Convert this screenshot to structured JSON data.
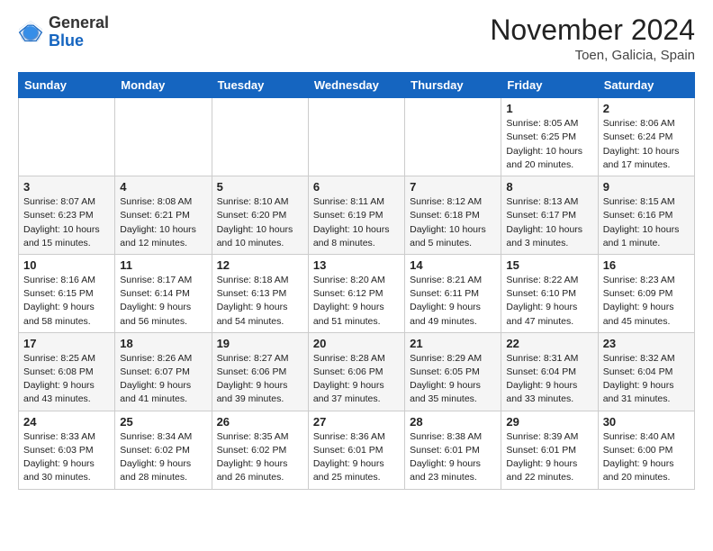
{
  "logo": {
    "general": "General",
    "blue": "Blue"
  },
  "header": {
    "month": "November 2024",
    "location": "Toen, Galicia, Spain"
  },
  "weekdays": [
    "Sunday",
    "Monday",
    "Tuesday",
    "Wednesday",
    "Thursday",
    "Friday",
    "Saturday"
  ],
  "weeks": [
    [
      {
        "day": "",
        "info": ""
      },
      {
        "day": "",
        "info": ""
      },
      {
        "day": "",
        "info": ""
      },
      {
        "day": "",
        "info": ""
      },
      {
        "day": "",
        "info": ""
      },
      {
        "day": "1",
        "info": "Sunrise: 8:05 AM\nSunset: 6:25 PM\nDaylight: 10 hours\nand 20 minutes."
      },
      {
        "day": "2",
        "info": "Sunrise: 8:06 AM\nSunset: 6:24 PM\nDaylight: 10 hours\nand 17 minutes."
      }
    ],
    [
      {
        "day": "3",
        "info": "Sunrise: 8:07 AM\nSunset: 6:23 PM\nDaylight: 10 hours\nand 15 minutes."
      },
      {
        "day": "4",
        "info": "Sunrise: 8:08 AM\nSunset: 6:21 PM\nDaylight: 10 hours\nand 12 minutes."
      },
      {
        "day": "5",
        "info": "Sunrise: 8:10 AM\nSunset: 6:20 PM\nDaylight: 10 hours\nand 10 minutes."
      },
      {
        "day": "6",
        "info": "Sunrise: 8:11 AM\nSunset: 6:19 PM\nDaylight: 10 hours\nand 8 minutes."
      },
      {
        "day": "7",
        "info": "Sunrise: 8:12 AM\nSunset: 6:18 PM\nDaylight: 10 hours\nand 5 minutes."
      },
      {
        "day": "8",
        "info": "Sunrise: 8:13 AM\nSunset: 6:17 PM\nDaylight: 10 hours\nand 3 minutes."
      },
      {
        "day": "9",
        "info": "Sunrise: 8:15 AM\nSunset: 6:16 PM\nDaylight: 10 hours\nand 1 minute."
      }
    ],
    [
      {
        "day": "10",
        "info": "Sunrise: 8:16 AM\nSunset: 6:15 PM\nDaylight: 9 hours\nand 58 minutes."
      },
      {
        "day": "11",
        "info": "Sunrise: 8:17 AM\nSunset: 6:14 PM\nDaylight: 9 hours\nand 56 minutes."
      },
      {
        "day": "12",
        "info": "Sunrise: 8:18 AM\nSunset: 6:13 PM\nDaylight: 9 hours\nand 54 minutes."
      },
      {
        "day": "13",
        "info": "Sunrise: 8:20 AM\nSunset: 6:12 PM\nDaylight: 9 hours\nand 51 minutes."
      },
      {
        "day": "14",
        "info": "Sunrise: 8:21 AM\nSunset: 6:11 PM\nDaylight: 9 hours\nand 49 minutes."
      },
      {
        "day": "15",
        "info": "Sunrise: 8:22 AM\nSunset: 6:10 PM\nDaylight: 9 hours\nand 47 minutes."
      },
      {
        "day": "16",
        "info": "Sunrise: 8:23 AM\nSunset: 6:09 PM\nDaylight: 9 hours\nand 45 minutes."
      }
    ],
    [
      {
        "day": "17",
        "info": "Sunrise: 8:25 AM\nSunset: 6:08 PM\nDaylight: 9 hours\nand 43 minutes."
      },
      {
        "day": "18",
        "info": "Sunrise: 8:26 AM\nSunset: 6:07 PM\nDaylight: 9 hours\nand 41 minutes."
      },
      {
        "day": "19",
        "info": "Sunrise: 8:27 AM\nSunset: 6:06 PM\nDaylight: 9 hours\nand 39 minutes."
      },
      {
        "day": "20",
        "info": "Sunrise: 8:28 AM\nSunset: 6:06 PM\nDaylight: 9 hours\nand 37 minutes."
      },
      {
        "day": "21",
        "info": "Sunrise: 8:29 AM\nSunset: 6:05 PM\nDaylight: 9 hours\nand 35 minutes."
      },
      {
        "day": "22",
        "info": "Sunrise: 8:31 AM\nSunset: 6:04 PM\nDaylight: 9 hours\nand 33 minutes."
      },
      {
        "day": "23",
        "info": "Sunrise: 8:32 AM\nSunset: 6:04 PM\nDaylight: 9 hours\nand 31 minutes."
      }
    ],
    [
      {
        "day": "24",
        "info": "Sunrise: 8:33 AM\nSunset: 6:03 PM\nDaylight: 9 hours\nand 30 minutes."
      },
      {
        "day": "25",
        "info": "Sunrise: 8:34 AM\nSunset: 6:02 PM\nDaylight: 9 hours\nand 28 minutes."
      },
      {
        "day": "26",
        "info": "Sunrise: 8:35 AM\nSunset: 6:02 PM\nDaylight: 9 hours\nand 26 minutes."
      },
      {
        "day": "27",
        "info": "Sunrise: 8:36 AM\nSunset: 6:01 PM\nDaylight: 9 hours\nand 25 minutes."
      },
      {
        "day": "28",
        "info": "Sunrise: 8:38 AM\nSunset: 6:01 PM\nDaylight: 9 hours\nand 23 minutes."
      },
      {
        "day": "29",
        "info": "Sunrise: 8:39 AM\nSunset: 6:01 PM\nDaylight: 9 hours\nand 22 minutes."
      },
      {
        "day": "30",
        "info": "Sunrise: 8:40 AM\nSunset: 6:00 PM\nDaylight: 9 hours\nand 20 minutes."
      }
    ]
  ]
}
